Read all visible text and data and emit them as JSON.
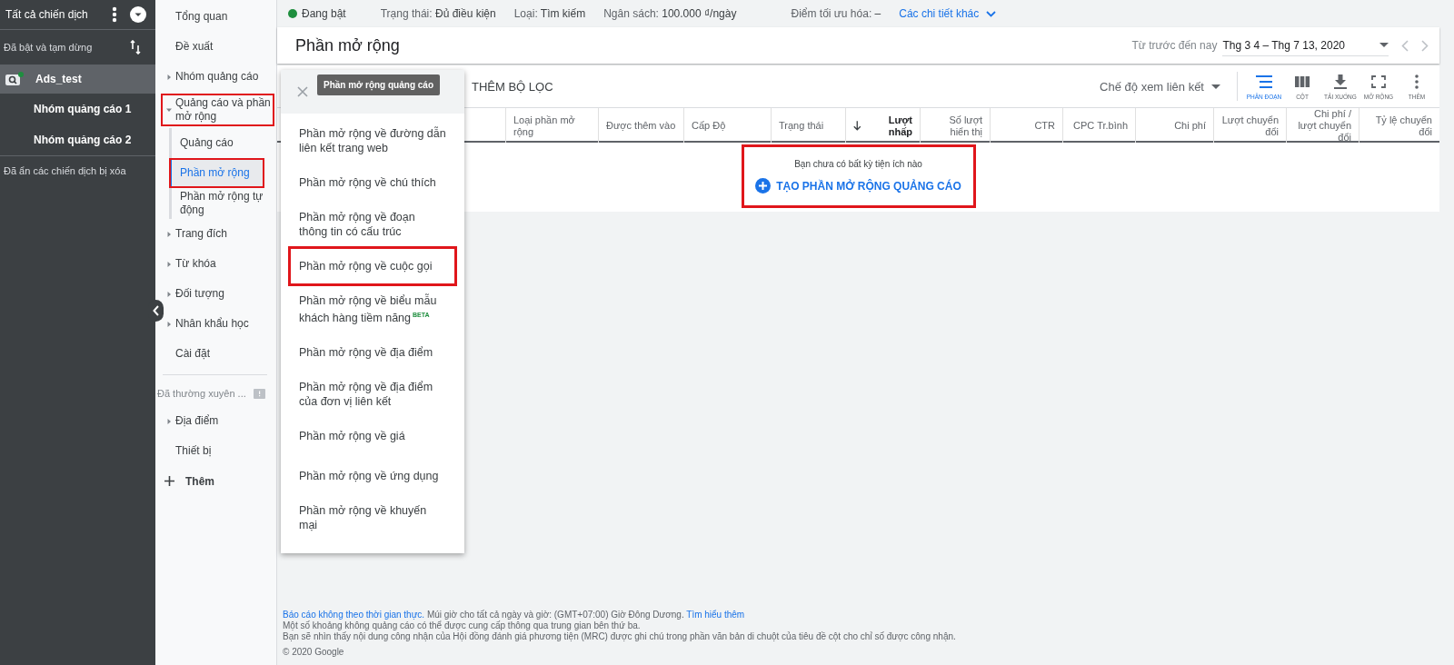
{
  "sidebar": {
    "title": "Tất cả chiến dịch",
    "filter": "Đã bật và tạm dừng",
    "campaigns": [
      {
        "name": "Ads_test",
        "enabled": true,
        "selected": true,
        "ad_groups": [
          {
            "name": "Nhóm quảng cáo 1",
            "selected": false
          },
          {
            "name": "Nhóm quảng cáo 2",
            "selected": false
          }
        ]
      }
    ],
    "hidden_note": "Đã ẩn các chiến dịch bị xóa"
  },
  "nav": {
    "items": [
      {
        "label": "Tổng quan",
        "selected": false,
        "highlighted": false
      },
      {
        "label": "Đề xuất",
        "selected": false,
        "highlighted": false
      },
      {
        "label": "Nhóm quảng cáo",
        "selected": false,
        "highlighted": false,
        "expanded": false
      },
      {
        "label": "Quảng cáo và phần mở rộng",
        "selected": false,
        "highlighted": true,
        "expanded": true,
        "children": [
          {
            "label": "Quảng cáo",
            "selected": false,
            "highlighted": false
          },
          {
            "label": "Phần mở rộng",
            "selected": true,
            "highlighted": true
          },
          {
            "label": "Phần mở rộng tự động",
            "selected": false,
            "highlighted": false
          }
        ]
      },
      {
        "label": "Trang đích",
        "selected": false,
        "highlighted": false,
        "expanded": false
      },
      {
        "label": "Từ khóa",
        "selected": false,
        "highlighted": false,
        "expanded": false
      },
      {
        "label": "Đối tượng",
        "selected": false,
        "highlighted": false,
        "expanded": false
      },
      {
        "label": "Nhân khẩu học",
        "selected": false,
        "highlighted": false,
        "expanded": false
      },
      {
        "label": "Cài đặt",
        "selected": false,
        "highlighted": false
      }
    ],
    "section": "Đã thường xuyên ...",
    "section_items": [
      {
        "label": "Địa điểm",
        "selected": false,
        "highlighted": false,
        "expanded": false
      },
      {
        "label": "Thiết bị",
        "selected": false,
        "highlighted": false
      }
    ],
    "add": "Thêm"
  },
  "status_bar": {
    "status": {
      "label": "Đang bật",
      "enabled": true
    },
    "fields": [
      {
        "label": "Trạng thái:",
        "value": "Đủ điều kiện"
      },
      {
        "label": "Loại:",
        "value": "Tìm kiếm"
      },
      {
        "label": "Ngân sách:",
        "value": "100.000 ₫/ngày"
      },
      {
        "label": "Điểm tối ưu hóa:",
        "value": "–"
      }
    ],
    "details_link": "Các chi tiết khác"
  },
  "header": {
    "title": "Phần mở rộng",
    "date_label": "Từ trước đến nay",
    "date_range": "Thg 3 4 – Thg 7 13, 2020"
  },
  "toolbar": {
    "filter_button": "THÊM BỘ LỌC",
    "view_mode": "Chế độ xem liên kết",
    "tools": [
      {
        "label": "PHÂN ĐOẠN",
        "kind": "segment",
        "selected": true
      },
      {
        "label": "CỘT",
        "kind": "columns",
        "selected": false
      },
      {
        "label": "TẢI XUỐNG",
        "kind": "download",
        "selected": false
      },
      {
        "label": "MỞ RỘNG",
        "kind": "expand",
        "selected": false
      },
      {
        "label": "THÊM",
        "kind": "more",
        "selected": false
      }
    ]
  },
  "table": {
    "columns": [
      {
        "label": "Loại phần mở rộng",
        "numeric": false,
        "sorted": false
      },
      {
        "label": "Được thêm vào",
        "numeric": false,
        "sorted": false
      },
      {
        "label": "Cấp Độ",
        "numeric": false,
        "sorted": false
      },
      {
        "label": "Trạng thái",
        "numeric": false,
        "sorted": false
      },
      {
        "label": "Lượt nhấp",
        "numeric": true,
        "sorted": true
      },
      {
        "label": "Số lượt hiển thị",
        "numeric": true,
        "sorted": false
      },
      {
        "label": "CTR",
        "numeric": true,
        "sorted": false
      },
      {
        "label": "CPC Tr.bình",
        "numeric": true,
        "sorted": false
      },
      {
        "label": "Chi phí",
        "numeric": true,
        "sorted": false
      },
      {
        "label": "Lượt chuyển đổi",
        "numeric": true,
        "sorted": false
      },
      {
        "label": "Chi phí / lượt chuyển đổi",
        "numeric": true,
        "sorted": false
      },
      {
        "label": "Tỷ lệ chuyển đổi",
        "numeric": true,
        "sorted": false
      }
    ],
    "empty_state": {
      "message": "Bạn chưa có bất kỳ tiện ích nào",
      "action": "TẠO PHẦN MỞ RỘNG QUẢNG CÁO",
      "highlighted": true
    }
  },
  "menu": {
    "tooltip": "Phần mở rộng quảng cáo",
    "items": [
      {
        "label": "Phần mở rộng về đường dẫn liên kết trang web",
        "highlighted": false
      },
      {
        "label": "Phần mở rộng về chú thích",
        "highlighted": false
      },
      {
        "label": "Phần mở rộng về đoạn thông tin có cấu trúc",
        "highlighted": false
      },
      {
        "label": "Phần mở rộng về cuộc gọi",
        "highlighted": true
      },
      {
        "label": "Phần mở rộng về biểu mẫu khách hàng tiềm năng",
        "highlighted": false,
        "badge": "BETA"
      },
      {
        "label": "Phần mở rộng về địa điểm",
        "highlighted": false
      },
      {
        "label": "Phần mở rộng về địa điểm của đơn vị liên kết",
        "highlighted": false
      },
      {
        "label": "Phần mở rộng về giá",
        "highlighted": false
      },
      {
        "label": "Phần mở rộng về ứng dụng",
        "highlighted": false
      },
      {
        "label": "Phần mở rộng về khuyến mại",
        "highlighted": false
      }
    ]
  },
  "footer": {
    "notice": {
      "link": "Báo cáo không theo thời gian thực.",
      "text": "Múi giờ cho tất cả ngày và giờ: (GMT+07:00) Giờ Đông Dương.",
      "link_2": "Tìm hiểu thêm"
    },
    "lines": [
      "Một số khoảng không quảng cáo có thể được cung cấp thông qua trung gian bên thứ ba.",
      "Bạn sẽ nhìn thấy nội dung công nhận của Hội đồng đánh giá phương tiện (MRC) được ghi chú trong phần văn bản di chuột của tiêu đề cột cho chỉ số được công nhận."
    ],
    "copyright": "© 2020 Google"
  }
}
